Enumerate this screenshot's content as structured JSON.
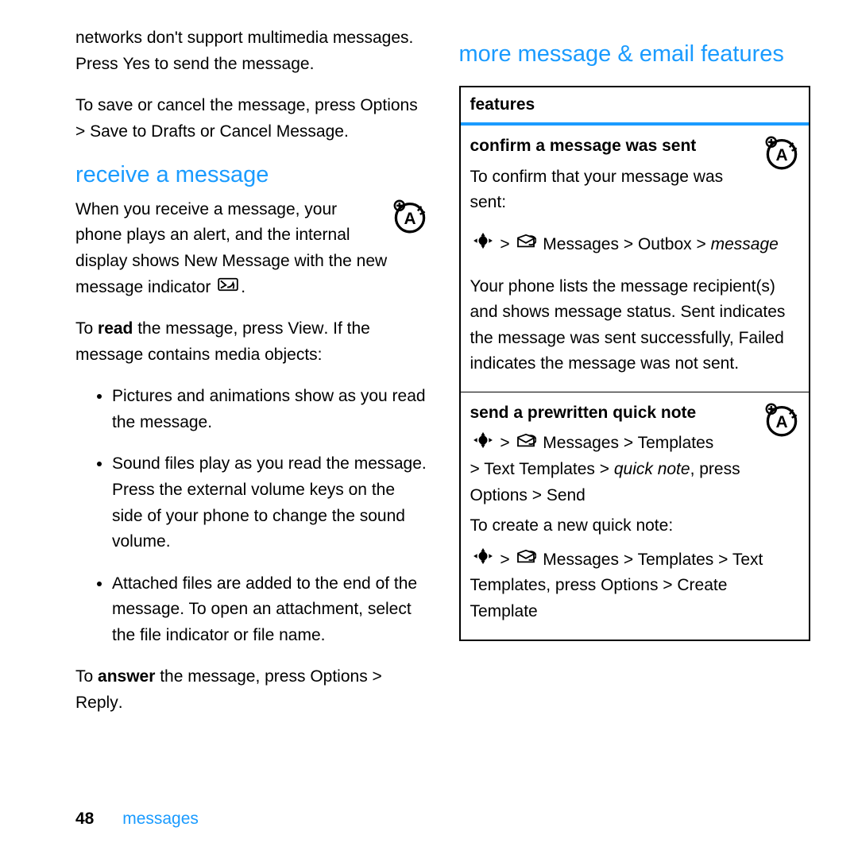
{
  "left": {
    "top": {
      "line1": "networks don't support multimedia messages. Press ",
      "yes": "Yes",
      "line1_end": " to send the message."
    },
    "save": {
      "a": "To save or cancel the message, press ",
      "options": "Options",
      "gt1": " > ",
      "save_drafts": "Save to Drafts",
      "or": " or ",
      "cancel": "Cancel Message",
      "dot": "."
    },
    "receive_heading": "receive a message",
    "receive_p1_a": "When you receive a message, your phone plays an alert, and the internal display shows ",
    "receive_p1_new": "New Message",
    "receive_p1_b": " with the new message indicator ",
    "receive_p1_dot": ".",
    "read_a": "To ",
    "read_bold": "read",
    "read_b": " the message, press ",
    "read_view": "View",
    "read_c": ". If the message contains media objects:",
    "bullets": {
      "b1": "Pictures and animations show as you read the message.",
      "b2": "Sound files play as you read the message. Press the external volume keys on the side of your phone to change the sound volume.",
      "b3": "Attached files are added to the end of the message. To open an attachment, select the file indicator or file name."
    },
    "answer_a": "To ",
    "answer_bold": "answer",
    "answer_b": " the message, press ",
    "answer_opts": "Options",
    "answer_gt": " > ",
    "answer_reply": "Reply",
    "answer_dot": "."
  },
  "right": {
    "heading": "more message & email features",
    "table_header": "features",
    "feat1": {
      "title": "confirm a message was sent",
      "p1": "To confirm that your message was sent:",
      "nav_gt1": " > ",
      "messages": "Messages",
      "gt2": " > ",
      "outbox": "Outbox",
      "gt3": " > ",
      "message_ital": "message",
      "p2_a": "Your phone lists the message recipient(s) and shows message status. ",
      "sent": "Sent",
      "p2_b": " indicates the message was sent successfully, ",
      "failed": "Failed",
      "p2_c": " indicates the message was not sent."
    },
    "feat2": {
      "title": "send a prewritten quick note",
      "gt1": " > ",
      "messages": "Messages",
      "gt2": " > ",
      "templates": "Templates",
      "line2_gt": "> ",
      "text_templates": "Text Templates",
      "gt3": " > ",
      "quick_note": "quick note",
      "press": ", press ",
      "options": "Options",
      "gt4": " > ",
      "send": "Send",
      "p3": "To create a new quick note:",
      "l4_gt1": " > ",
      "l4_messages": "Messages",
      "l4_gt2": " > ",
      "l4_templates": "Templates",
      "l4_gt3": " > ",
      "l4_text_templates": "Text Templates",
      "l4_comma": ", ",
      "l4_press": "press ",
      "l4_options": "Options",
      "l4_gt4": " > ",
      "l4_create": "Create Template"
    }
  },
  "footer": {
    "page": "48",
    "section": "messages"
  }
}
